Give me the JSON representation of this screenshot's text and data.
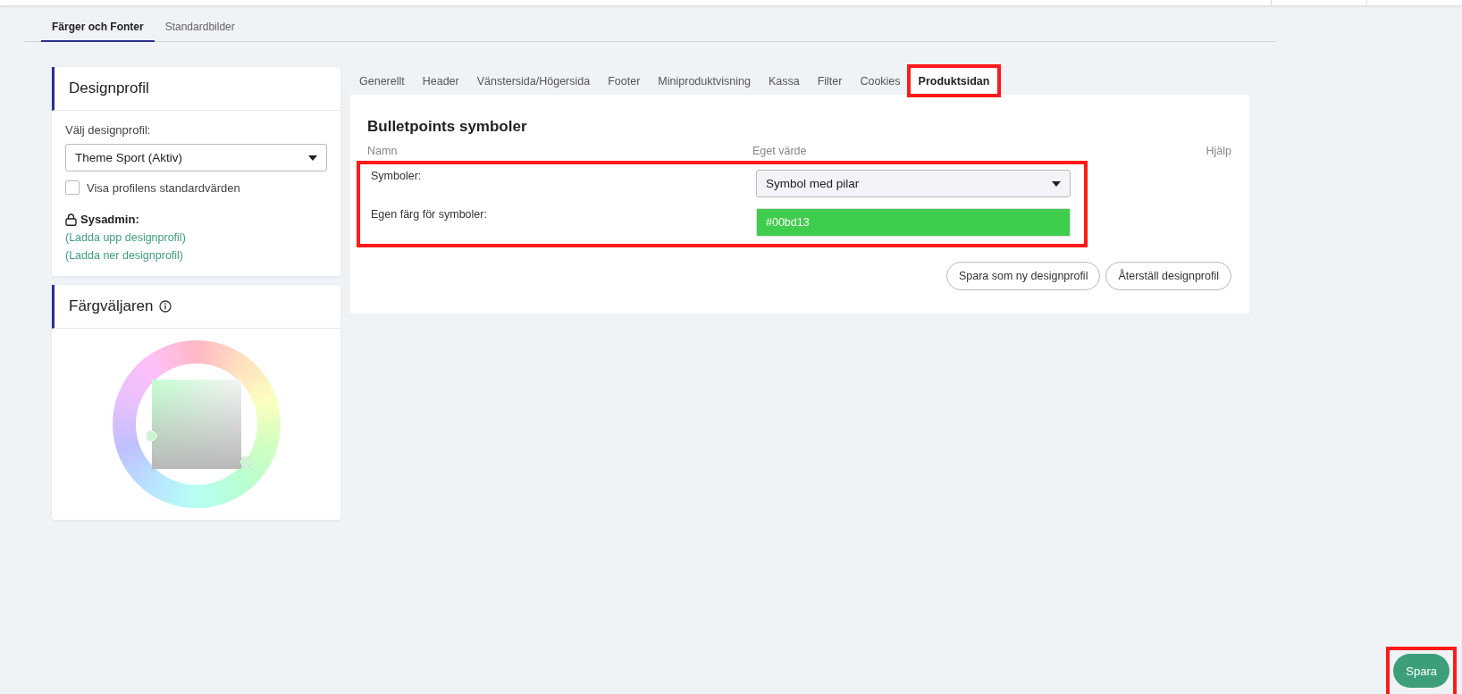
{
  "top_tabs": [
    {
      "label": "Färger och Fonter",
      "selected": true
    },
    {
      "label": "Standardbilder",
      "selected": false
    }
  ],
  "profile_card": {
    "title": "Designprofil",
    "select_label": "Välj designprofil:",
    "select_value": "Theme Sport (Aktiv)",
    "checkbox": {
      "label": "Visa profilens standardvärden",
      "checked": false
    },
    "sysadmin_label": "Sysadmin:",
    "links": [
      "(Ladda upp designprofil)",
      "(Ladda ner designprofil)"
    ]
  },
  "picker_card": {
    "title": "Färgväljaren"
  },
  "section_tabs": [
    {
      "label": "Generellt",
      "selected": false,
      "highlighted": false
    },
    {
      "label": "Header",
      "selected": false,
      "highlighted": false
    },
    {
      "label": "Vänstersida/Högersida",
      "selected": false,
      "highlighted": false
    },
    {
      "label": "Footer",
      "selected": false,
      "highlighted": false
    },
    {
      "label": "Miniproduktvisning",
      "selected": false,
      "highlighted": false
    },
    {
      "label": "Kassa",
      "selected": false,
      "highlighted": false
    },
    {
      "label": "Filter",
      "selected": false,
      "highlighted": false
    },
    {
      "label": "Cookies",
      "selected": false,
      "highlighted": false
    },
    {
      "label": "Produktsidan",
      "selected": true,
      "highlighted": true
    }
  ],
  "section": {
    "title": "Bulletpoints symboler",
    "columns": [
      "Namn",
      "Eget värde",
      "Hjälp"
    ],
    "highlighted": true,
    "rows": [
      {
        "label": "Symboler:",
        "kind": "select",
        "value": "Symbol med pilar"
      },
      {
        "label": "Egen färg för symboler:",
        "kind": "color",
        "value": "#00bd13"
      }
    ]
  },
  "actions": [
    "Spara som ny designprofil",
    "Återställ designprofil"
  ],
  "save_button": {
    "label": "Spara",
    "highlighted": true
  }
}
